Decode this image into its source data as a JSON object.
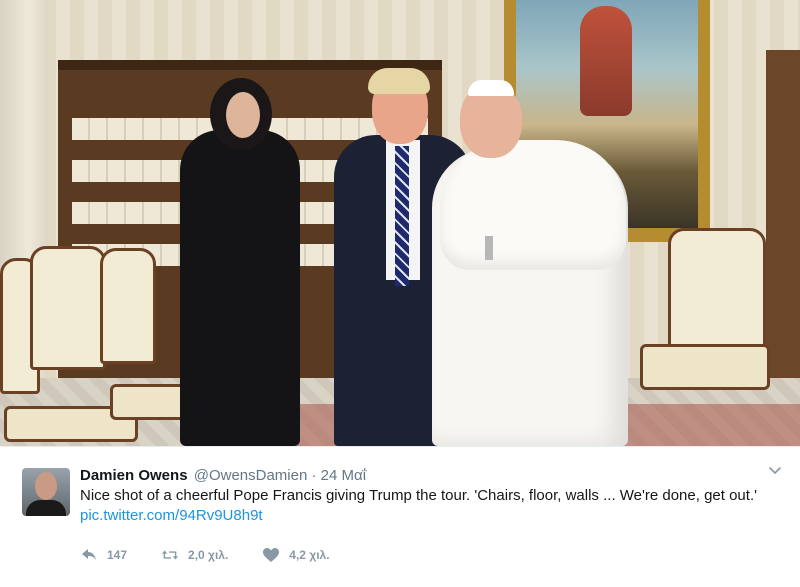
{
  "tweet": {
    "author_name": "Damien Owens",
    "author_handle": "@OwensDamien",
    "separator": "·",
    "timestamp": "24 Μαΐ",
    "text": "Nice shot of a cheerful Pope Francis giving Trump the tour. 'Chairs, floor, walls ... We're done, get out.'",
    "link": "pic.twitter.com/94Rv9U8h9t"
  },
  "actions": {
    "reply_count": "147",
    "retweet_count": "2,0 χιλ.",
    "like_count": "4,2 χιλ."
  },
  "icons": {
    "menu": "chevron-down-icon",
    "reply": "reply-icon",
    "retweet": "retweet-icon",
    "like": "heart-icon"
  },
  "colors": {
    "link": "#1b95e0",
    "muted": "#8899a6",
    "text": "#14171a"
  }
}
